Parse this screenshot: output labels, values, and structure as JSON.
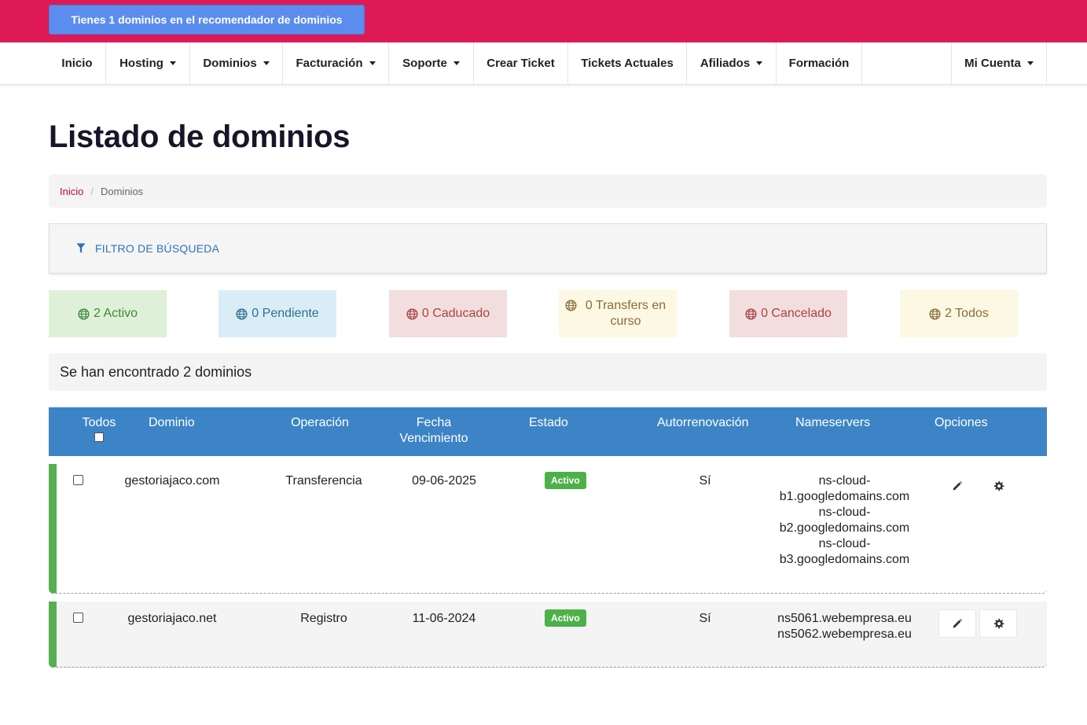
{
  "topbar": {
    "recommender_label": "Tienes 1 dominios en el recomendador de dominios"
  },
  "nav": {
    "items": [
      {
        "label": "Inicio"
      },
      {
        "label": "Hosting"
      },
      {
        "label": "Dominios"
      },
      {
        "label": "Facturación"
      },
      {
        "label": "Soporte"
      },
      {
        "label": "Crear Ticket"
      },
      {
        "label": "Tickets Actuales"
      },
      {
        "label": "Afiliados"
      },
      {
        "label": "Formación"
      }
    ],
    "account": "Mi Cuenta"
  },
  "page": {
    "title": "Listado de dominios"
  },
  "breadcrumb": {
    "home": "Inicio",
    "current": "Dominios"
  },
  "filter": {
    "label": "FILTRO DE BÚSQUEDA"
  },
  "status_filters": [
    {
      "label": "2 Activo",
      "color": "#3e8a3a",
      "bg": "#dff0d8"
    },
    {
      "label": "0 Pendiente",
      "color": "#31708f",
      "bg": "#d9edf7"
    },
    {
      "label": "0 Caducado",
      "color": "#a94442",
      "bg": "#f2dede"
    },
    {
      "label": "0 Transfers en curso",
      "color": "#8a6d3b",
      "bg": "#fcf8e3"
    },
    {
      "label": "0 Cancelado",
      "color": "#a94442",
      "bg": "#f2dede"
    },
    {
      "label": "2 Todos",
      "color": "#8a6d3b",
      "bg": "#fcf8e3"
    }
  ],
  "results": {
    "summary": "Se han encontrado 2 dominios"
  },
  "table": {
    "headers": {
      "select_all": "Todos",
      "domain": "Dominio",
      "operation": "Operación",
      "expiry_line1": "Fecha",
      "expiry_line2": "Vencimiento",
      "status": "Estado",
      "autorenew": "Autorrenovación",
      "nameservers": "Nameservers",
      "options": "Opciones"
    },
    "rows": [
      {
        "domain": "gestoriajaco.com",
        "operation": "Transferencia",
        "expiry": "09-06-2025",
        "status": "Activo",
        "autorenew": "Sí",
        "ns": [
          "ns-cloud-",
          "b1.googledomains.com",
          "ns-cloud-",
          "b2.googledomains.com",
          "ns-cloud-",
          "b3.googledomains.com"
        ]
      },
      {
        "domain": "gestoriajaco.net",
        "operation": "Registro",
        "expiry": "11-06-2024",
        "status": "Activo",
        "autorenew": "Sí",
        "ns": [
          "ns5061.webempresa.eu",
          "ns5062.webempresa.eu"
        ]
      }
    ]
  },
  "colors": {
    "topbar": "#dd1a56",
    "recommender_button": "#5b8def",
    "table_header": "#3d84c6",
    "active_badge": "#4db14a",
    "row_accent": "#55b04f"
  }
}
